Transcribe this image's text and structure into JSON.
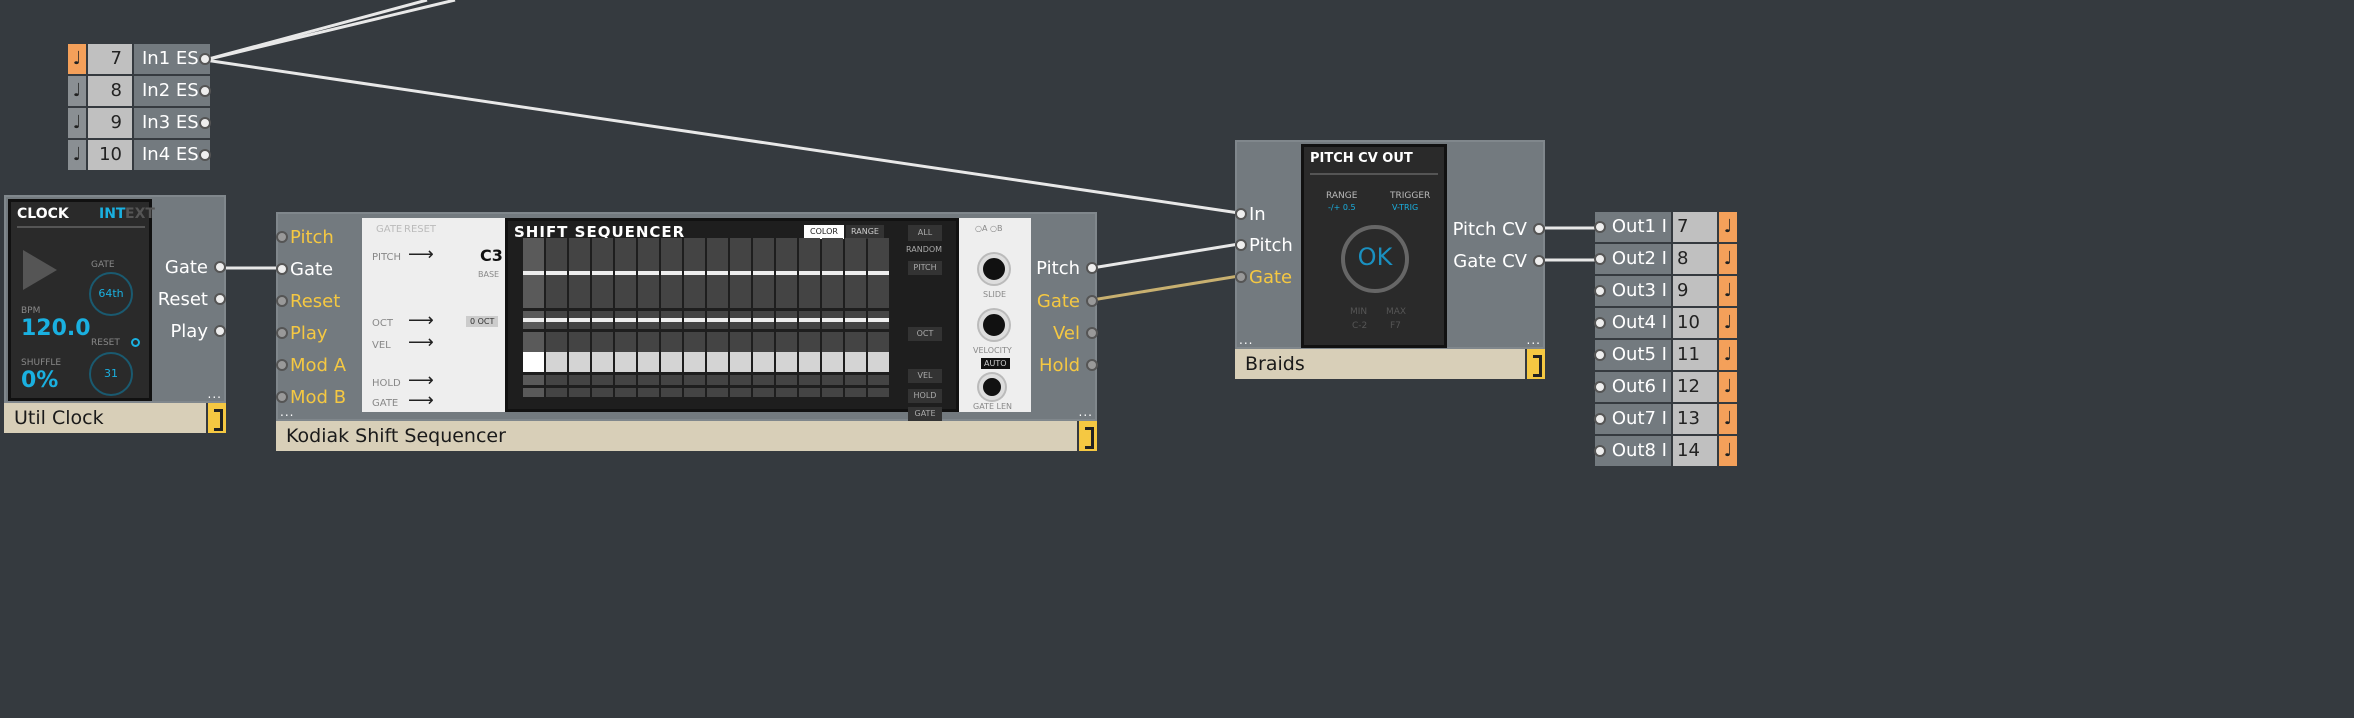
{
  "colors": {
    "background": "#353a3f",
    "module": "#737a7f",
    "title_bar": "#d8cfb8",
    "tag": "#f5c842",
    "note_active": "#f4a05a",
    "accent_blue": "#1ab0e0",
    "wire": "#e8e8e8",
    "wire_gate": "#c8b070"
  },
  "inputs": [
    {
      "num": "7",
      "label": "In1 ES",
      "active": true
    },
    {
      "num": "8",
      "label": "In2 ES",
      "active": false
    },
    {
      "num": "9",
      "label": "In3 ES",
      "active": false
    },
    {
      "num": "10",
      "label": "In4 ES",
      "active": false
    }
  ],
  "clock": {
    "title": "Util Clock",
    "panel": {
      "name": "CLOCK",
      "int": "INT",
      "ext": "EXT",
      "gate_label": "GATE",
      "gate_value": "64th",
      "bpm_label": "BPM",
      "bpm": "120.0",
      "reset_label": "RESET",
      "reset_value": "31",
      "shuffle_label": "SHUFFLE",
      "shuffle": "0%"
    },
    "outputs": [
      "Gate",
      "Reset",
      "Play"
    ]
  },
  "sequencer": {
    "title": "Kodiak Shift Sequencer",
    "inputs": [
      "Pitch",
      "Gate",
      "Reset",
      "Play",
      "Mod A",
      "Mod B"
    ],
    "outputs": [
      "Pitch",
      "Gate",
      "Vel",
      "Hold"
    ],
    "panel": {
      "name": "SHIFT SEQUENCER",
      "color_btn": "COLOR",
      "range_btn": "RANGE",
      "all_btn": "ALL",
      "random": "RANDOM",
      "rand_buttons": [
        "PITCH",
        "OCT",
        "VEL",
        "HOLD",
        "GATE"
      ],
      "left": {
        "gate": "GATE",
        "reset": "RESET",
        "pitch": "PITCH",
        "base_note": "C3",
        "base": "BASE",
        "oct": "OCT",
        "oct_value": "0 OCT",
        "vel": "VEL",
        "hold": "HOLD",
        "gate2": "GATE"
      },
      "right": {
        "ab": "○A ○B",
        "slide": "SLIDE",
        "velocity": "VELOCITY",
        "auto": "AUTO",
        "gate_len": "GATE LEN"
      },
      "steps": 16
    }
  },
  "braids": {
    "title": "Braids",
    "inputs": [
      "In",
      "Pitch",
      "Gate"
    ],
    "outputs": [
      "Pitch CV",
      "Gate CV"
    ],
    "panel": {
      "name": "PITCH CV OUT",
      "range_label": "RANGE",
      "range": "-/+ 0.5",
      "trigger_label": "TRIGGER",
      "trigger": "V-TRIG",
      "status": "OK",
      "min_label": "MIN",
      "min": "C-2",
      "max_label": "MAX",
      "max": "F7"
    }
  },
  "outputs": [
    {
      "label": "Out1 I",
      "num": "7"
    },
    {
      "label": "Out2 I",
      "num": "8"
    },
    {
      "label": "Out3 I",
      "num": "9"
    },
    {
      "label": "Out4 I",
      "num": "10"
    },
    {
      "label": "Out5 I",
      "num": "11"
    },
    {
      "label": "Out6 I",
      "num": "12"
    },
    {
      "label": "Out7 I",
      "num": "13"
    },
    {
      "label": "Out8 I",
      "num": "14"
    }
  ],
  "ellipsis": "..."
}
